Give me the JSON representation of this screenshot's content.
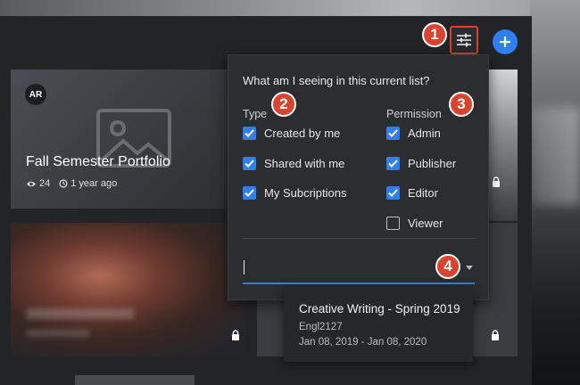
{
  "header": {
    "filter_icon": "sliders-icon",
    "add_icon": "plus-icon"
  },
  "callouts": [
    "1",
    "2",
    "3",
    "4"
  ],
  "cards": [
    {
      "avatar": "AR",
      "title": "Fall Semester Portfolio",
      "views": "24",
      "time": "1 year ago"
    }
  ],
  "filter_panel": {
    "heading": "What am I seeing in this current list?",
    "type": {
      "label": "Type",
      "options": [
        {
          "label": "Created by me",
          "checked": true
        },
        {
          "label": "Shared with me",
          "checked": true
        },
        {
          "label": "My Subcriptions",
          "checked": true
        }
      ]
    },
    "permission": {
      "label": "Permission",
      "options": [
        {
          "label": "Admin",
          "checked": true
        },
        {
          "label": "Publisher",
          "checked": true
        },
        {
          "label": "Editor",
          "checked": true
        },
        {
          "label": "Viewer",
          "checked": false
        }
      ]
    },
    "select_value": ""
  },
  "popover": {
    "title": "Creative Writing - Spring 2019",
    "code": "Engl2127",
    "dates": "Jan 08, 2019 - Jan 08, 2020"
  },
  "colors": {
    "accent": "#2f7ff0",
    "callout": "#d9432f"
  }
}
